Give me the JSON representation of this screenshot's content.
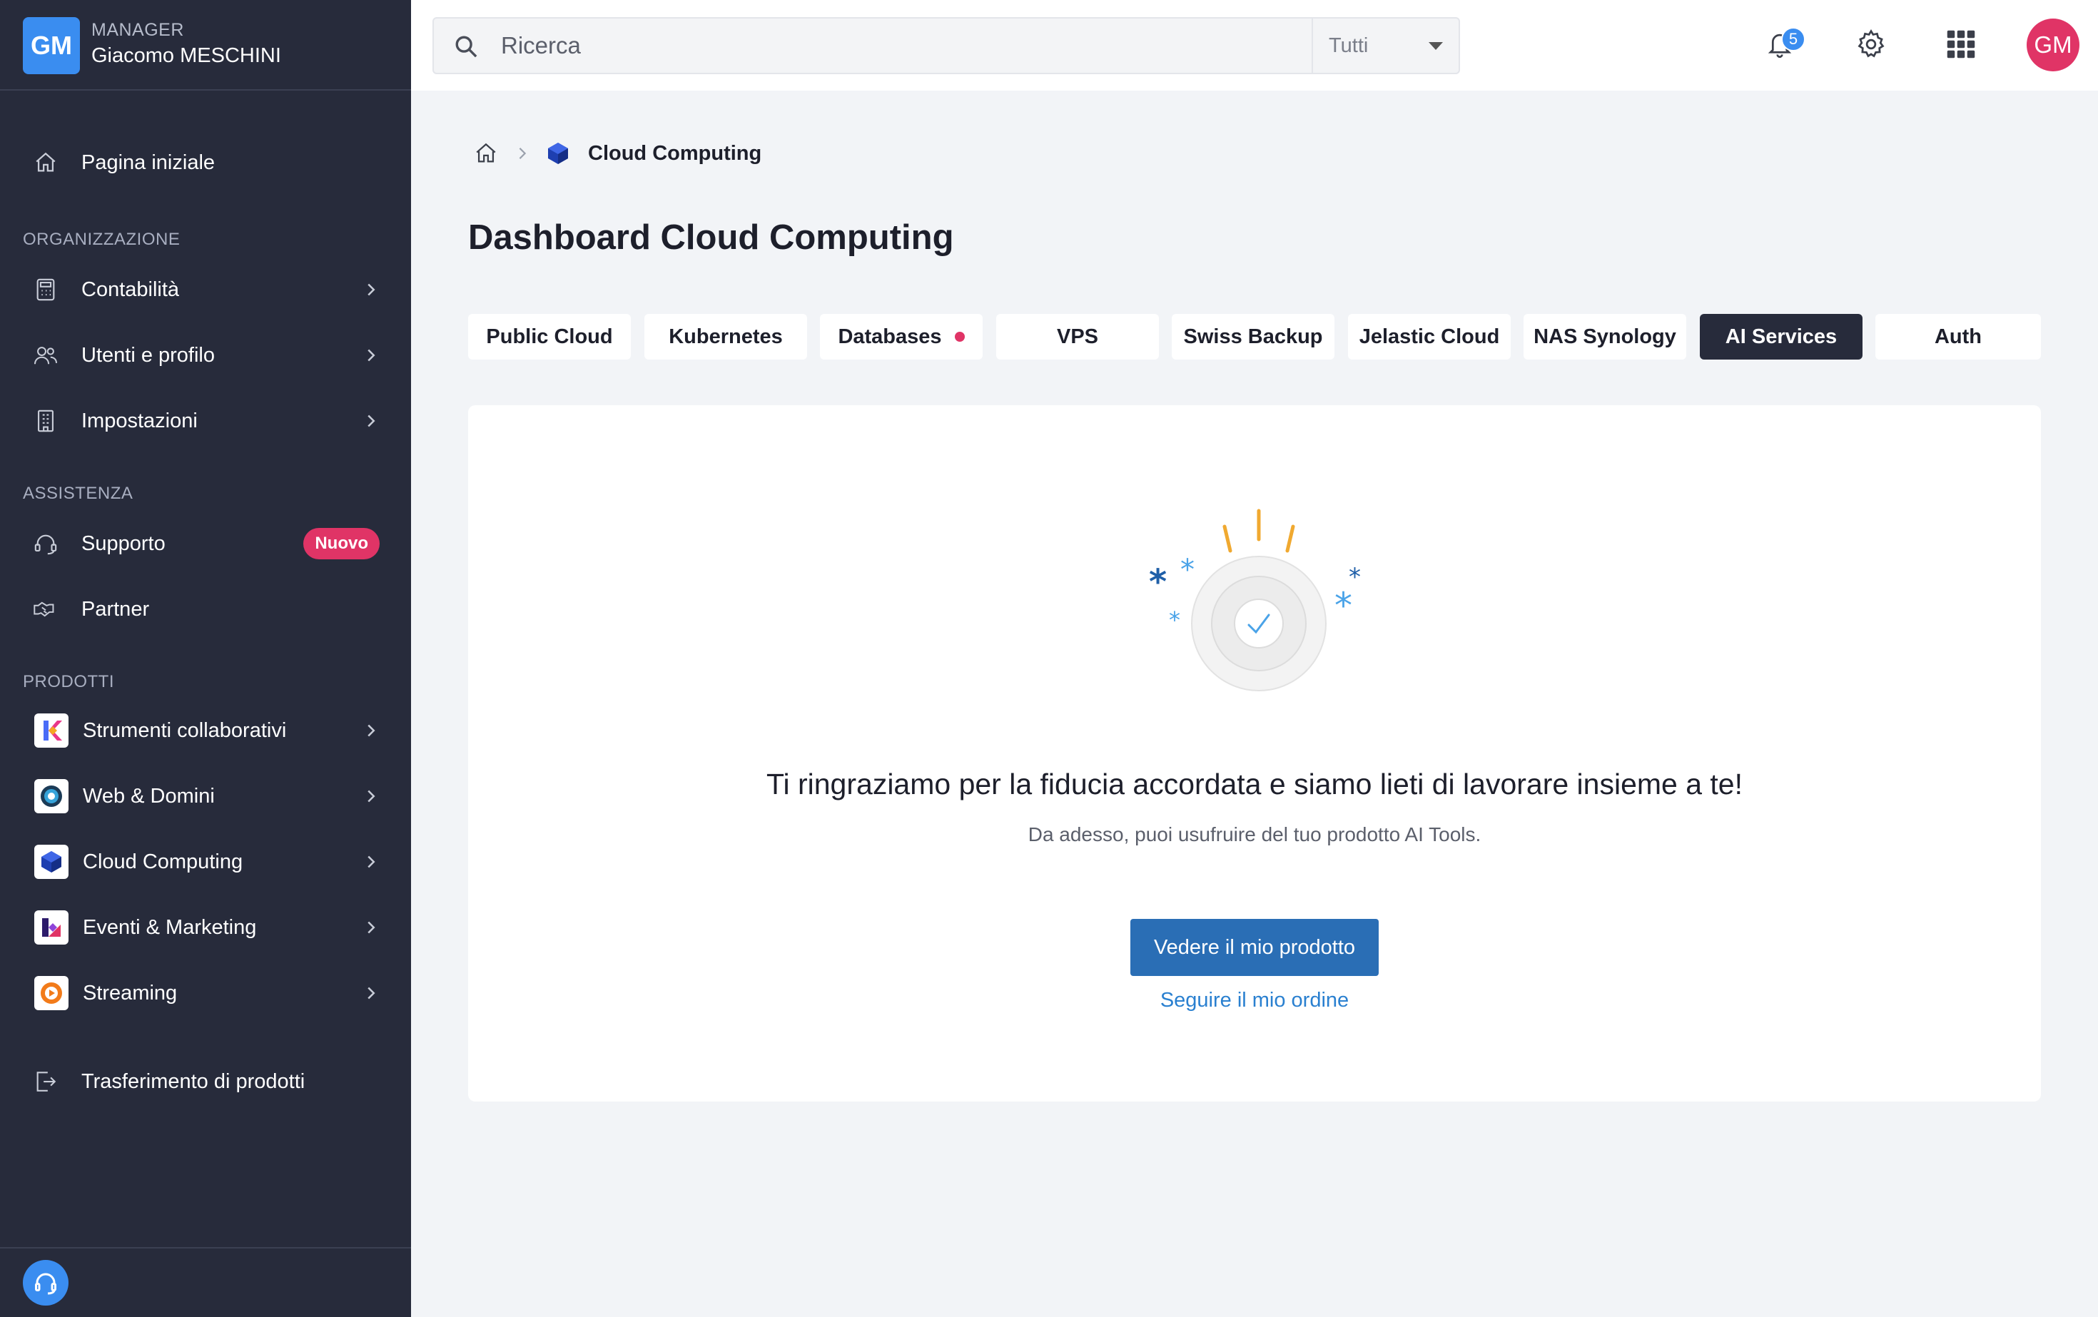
{
  "user": {
    "initials": "GM",
    "role": "MANAGER",
    "name": "Giacomo MESCHINI"
  },
  "sidebar": {
    "home": "Pagina iniziale",
    "sections": {
      "organization": "ORGANIZZAZIONE",
      "assistance": "ASSISTENZA",
      "products": "PRODOTTI"
    },
    "organization_items": [
      {
        "label": "Contabilità",
        "icon": "calculator-icon"
      },
      {
        "label": "Utenti e profilo",
        "icon": "users-icon"
      },
      {
        "label": "Impostazioni",
        "icon": "building-icon"
      }
    ],
    "support": {
      "label": "Supporto",
      "badge": "Nuovo"
    },
    "partner": "Partner",
    "products": [
      {
        "label": "Strumenti collaborativi",
        "icon": "kchat-logo-icon"
      },
      {
        "label": "Web & Domini",
        "icon": "web-domains-logo-icon"
      },
      {
        "label": "Cloud Computing",
        "icon": "cloud-cube-icon"
      },
      {
        "label": "Eventi & Marketing",
        "icon": "events-logo-icon"
      },
      {
        "label": "Streaming",
        "icon": "streaming-logo-icon"
      }
    ],
    "transfer": "Trasferimento di prodotti"
  },
  "topbar": {
    "search_placeholder": "Ricerca",
    "search_scope": "Tutti",
    "notifications_count": "5",
    "avatar_initials": "GM"
  },
  "breadcrumb": {
    "current": "Cloud Computing"
  },
  "page": {
    "title": "Dashboard Cloud Computing"
  },
  "tabs": [
    {
      "label": "Public Cloud"
    },
    {
      "label": "Kubernetes"
    },
    {
      "label": "Databases",
      "dot": true
    },
    {
      "label": "VPS"
    },
    {
      "label": "Swiss Backup"
    },
    {
      "label": "Jelastic Cloud"
    },
    {
      "label": "NAS Synology"
    },
    {
      "label": "AI Services",
      "active": true
    },
    {
      "label": "Auth"
    }
  ],
  "confirmation": {
    "heading": "Ti ringraziamo per la fiducia accordata e siamo lieti di lavorare insieme a te!",
    "text": "Da adesso, puoi usufruire del tuo prodotto AI Tools.",
    "primary_button": "Vedere il mio prodotto",
    "secondary_link": "Seguire il mio ordine"
  },
  "colors": {
    "sidebar_bg": "#272b3b",
    "accent_blue": "#3a8df0",
    "badge_pink": "#e03466",
    "primary_button": "#2a6eb5"
  }
}
